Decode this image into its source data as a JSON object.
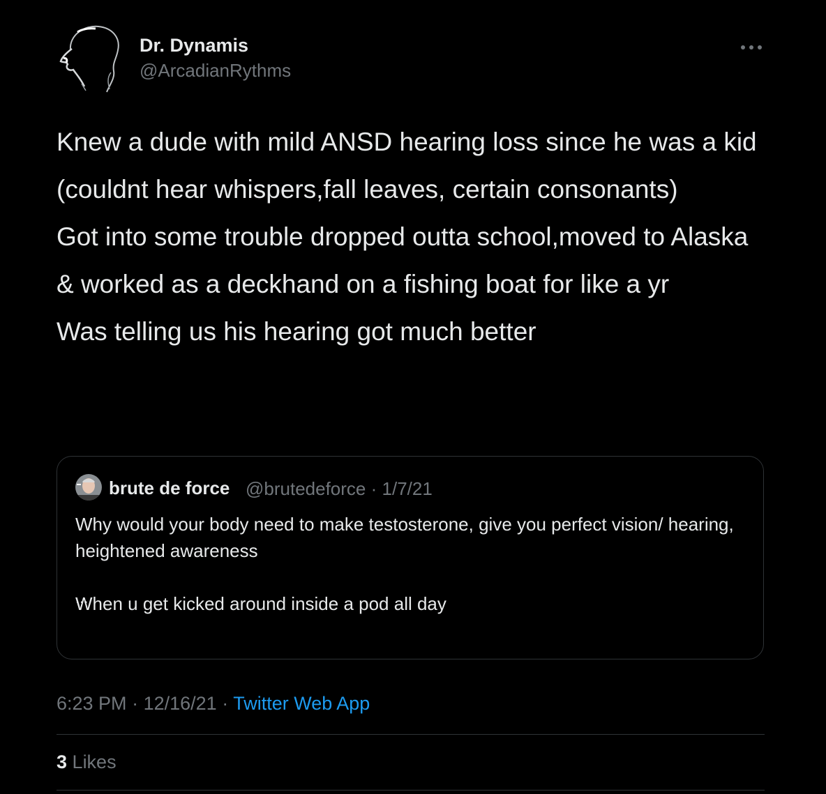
{
  "author": {
    "display_name": "Dr. Dynamis",
    "handle": "@ArcadianRythms",
    "avatar_icon": "profile-silhouette-avatar"
  },
  "more_icon": "more-options-icon",
  "tweet": {
    "lines": [
      "Knew a dude with mild ANSD hearing loss since he was a kid",
      "(couldnt hear whispers,fall leaves, certain consonants)",
      "Got into some trouble dropped outta school,moved to Alaska",
      "& worked as a deckhand on a fishing boat for like a yr",
      "Was telling us his hearing got much better"
    ]
  },
  "quote": {
    "display_name": "brute de force",
    "handle": "@brutedeforce",
    "separator": "·",
    "date": "1/7/21",
    "text_1": "Why would your body need to make testosterone, give you perfect vision/ hearing, heightened awareness",
    "text_2": "When u get kicked around inside a pod all day",
    "truncation": "..."
  },
  "meta": {
    "time": "6:23 PM",
    "separator": "·",
    "date": "12/16/21",
    "source": "Twitter Web App"
  },
  "likes": {
    "count": "3",
    "label": "Likes"
  },
  "colors": {
    "background": "#000000",
    "text": "#e7e9ea",
    "secondary_text": "#71767b",
    "link": "#1d9bf0",
    "border": "#2f3336"
  }
}
